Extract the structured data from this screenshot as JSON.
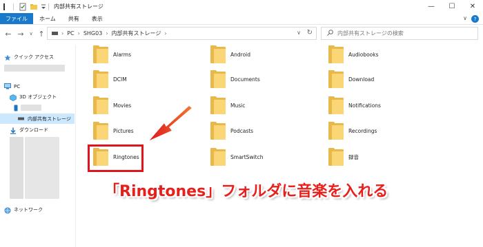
{
  "window": {
    "title": "内部共有ストレージ",
    "minimize": "—",
    "maximize": "☐",
    "close": "✕"
  },
  "ribbon": {
    "tabs": [
      "ファイル",
      "ホーム",
      "共有",
      "表示"
    ],
    "collapse_glyph": "∨",
    "help_glyph": "?"
  },
  "nav": {
    "back": "←",
    "forward": "→",
    "recent": "∨",
    "up": "↑",
    "breadcrumb": [
      "PC",
      "SHG03",
      "内部共有ストレージ"
    ],
    "separator": "›",
    "dropdown": "∨",
    "refresh": "↻",
    "search_placeholder": "内部共有ストレージの検索"
  },
  "sidebar": {
    "quick_access": "クイック アクセス",
    "pc": "PC",
    "objects_3d": "3D オブジェクト",
    "internal_storage": "内部共有ストレージ",
    "downloads": "ダウンロード",
    "network": "ネットワーク"
  },
  "folders": [
    "Alarms",
    "Android",
    "Audiobooks",
    "DCIM",
    "Documents",
    "Download",
    "Movies",
    "Music",
    "Notifications",
    "Pictures",
    "Podcasts",
    "Recordings",
    "Ringtones",
    "SmartSwitch",
    "録音"
  ],
  "annotation": {
    "caption": "「Ringtones」フォルダに音楽を入れる",
    "highlight_color": "#e0141c",
    "caption_color": "#e8201c"
  },
  "colors": {
    "file_tab": "#1979ca",
    "folder_back": "#e8b84a",
    "folder_front": "#fbd677",
    "selection": "#cce8ff"
  },
  "icons": {
    "quick_access": "star-icon",
    "pc": "monitor-icon",
    "objects_3d": "cube-icon",
    "phone": "phone-icon",
    "storage": "drive-icon",
    "downloads": "download-icon",
    "network": "network-icon",
    "search": "search-icon",
    "folder": "folder-icon"
  }
}
